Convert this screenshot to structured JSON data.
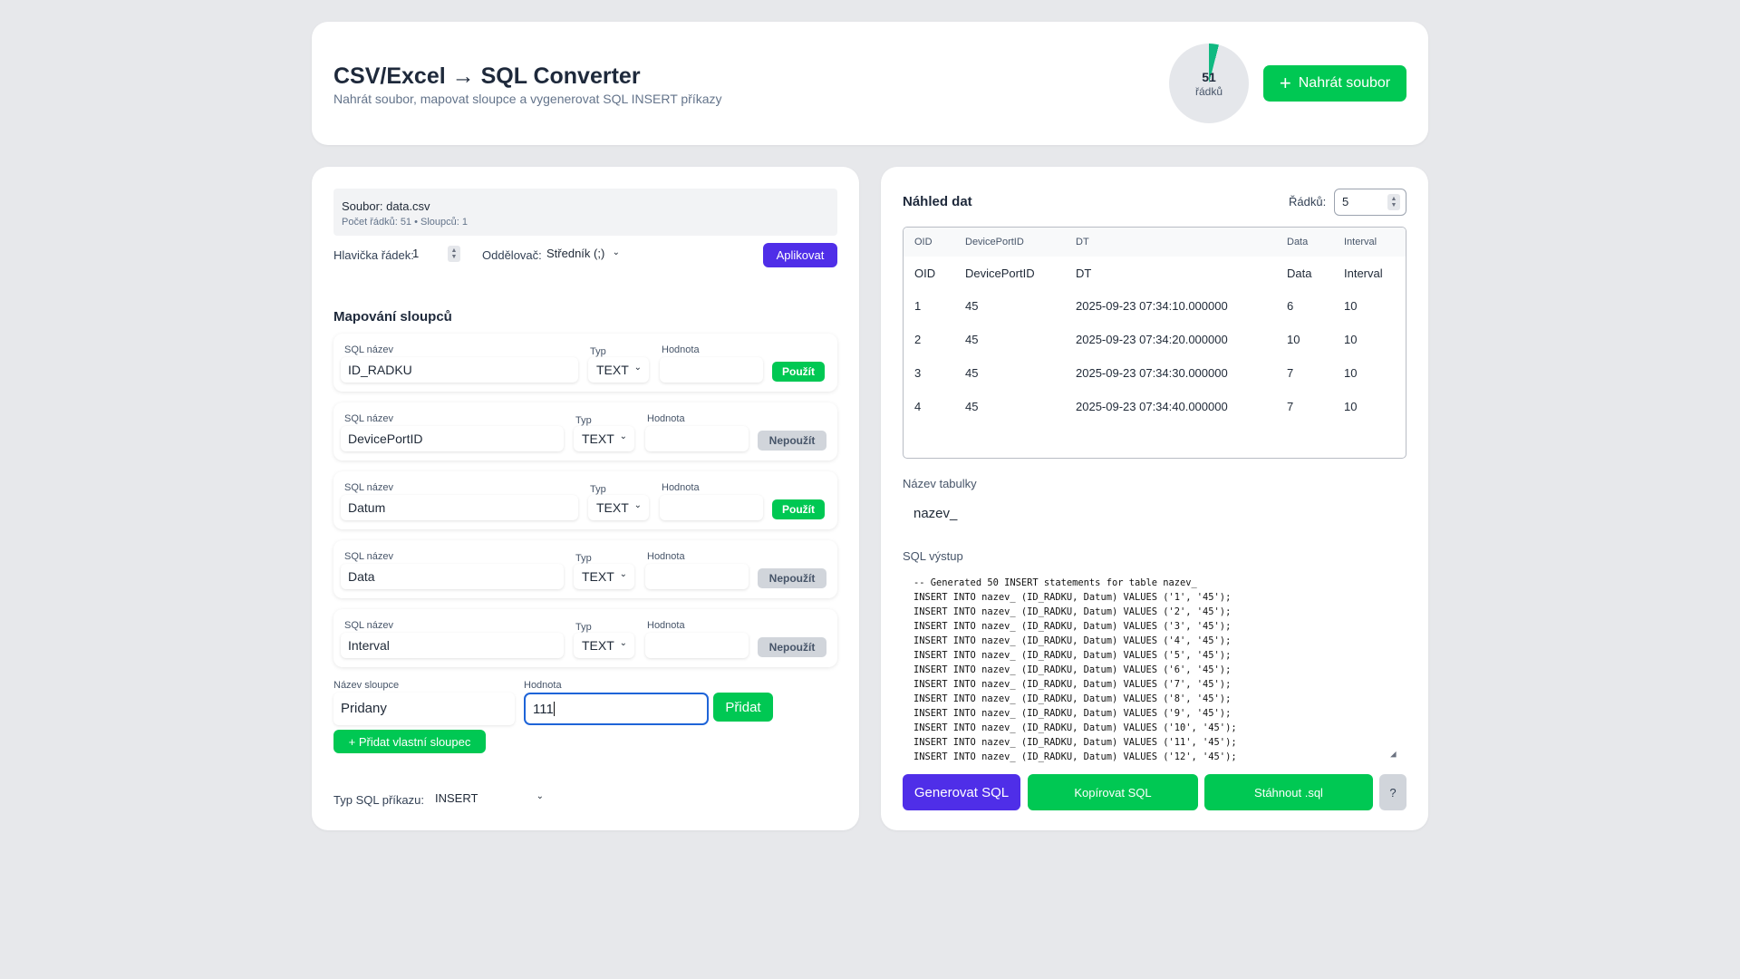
{
  "header": {
    "title": "CSV/Excel → SQL Converter",
    "subtitle": "Nahrát soubor, mapovat sloupce a vygenerovat SQL INSERT příkazy",
    "row_count": "51",
    "row_count_label": "řádků",
    "row_gauge_fraction": 0.04,
    "upload_label": "Nahrát soubor",
    "upload_icon": "plus-icon"
  },
  "file": {
    "name": "Soubor: data.csv",
    "meta": "Počet řádků: 51 • Sloupců: 1"
  },
  "options": {
    "header_row_label": "Hlavička řádek:",
    "header_row_value": "1",
    "delimiter_label": "Oddělovač:",
    "delimiter_value": "Středník (;)",
    "apply_label": "Aplikovat"
  },
  "mapping": {
    "title": "Mapování sloupců",
    "name_caption": "SQL název",
    "type_caption": "Typ",
    "value_caption": "Hodnota",
    "rows": [
      {
        "name": "ID_RADKU",
        "type": "TEXT",
        "value": "",
        "button": "Použít",
        "active": true
      },
      {
        "name": "DevicePortID",
        "type": "TEXT",
        "value": "",
        "button": "Nepoužít",
        "active": false
      },
      {
        "name": "Datum",
        "type": "TEXT",
        "value": "",
        "button": "Použít",
        "active": true
      },
      {
        "name": "Data",
        "type": "TEXT",
        "value": "",
        "button": "Nepoužít",
        "active": false
      },
      {
        "name": "Interval",
        "type": "TEXT",
        "value": "",
        "button": "Nepoužít",
        "active": false
      }
    ]
  },
  "add_column": {
    "name_label": "Název sloupce",
    "name_value": "Pridany",
    "value_label": "Hodnota",
    "value_value": "111",
    "add_label": "Přidat",
    "custom_label": "+ Přidat vlastní sloupec"
  },
  "sql_type": {
    "label": "Typ SQL příkazu:",
    "value": "INSERT"
  },
  "preview": {
    "title": "Náhled dat",
    "rows_label": "Řádků:",
    "rows_value": "5",
    "columns": [
      "OID",
      "DevicePortID",
      "DT",
      "Data",
      "Interval"
    ],
    "rows": [
      [
        "OID",
        "DevicePortID",
        "DT",
        "Data",
        "Interval"
      ],
      [
        "1",
        "45",
        "2025-09-23 07:34:10.000000",
        "6",
        "10"
      ],
      [
        "2",
        "45",
        "2025-09-23 07:34:20.000000",
        "10",
        "10"
      ],
      [
        "3",
        "45",
        "2025-09-23 07:34:30.000000",
        "7",
        "10"
      ],
      [
        "4",
        "45",
        "2025-09-23 07:34:40.000000",
        "7",
        "10"
      ]
    ]
  },
  "table_name": {
    "label": "Název tabulky",
    "value": "nazev_"
  },
  "sql_output": {
    "label": "SQL výstup",
    "lines": [
      "-- Generated 50 INSERT statements for table nazev_",
      "INSERT INTO nazev_ (ID_RADKU, Datum) VALUES ('1', '45');",
      "INSERT INTO nazev_ (ID_RADKU, Datum) VALUES ('2', '45');",
      "INSERT INTO nazev_ (ID_RADKU, Datum) VALUES ('3', '45');",
      "INSERT INTO nazev_ (ID_RADKU, Datum) VALUES ('4', '45');",
      "INSERT INTO nazev_ (ID_RADKU, Datum) VALUES ('5', '45');",
      "INSERT INTO nazev_ (ID_RADKU, Datum) VALUES ('6', '45');",
      "INSERT INTO nazev_ (ID_RADKU, Datum) VALUES ('7', '45');",
      "INSERT INTO nazev_ (ID_RADKU, Datum) VALUES ('8', '45');",
      "INSERT INTO nazev_ (ID_RADKU, Datum) VALUES ('9', '45');",
      "INSERT INTO nazev_ (ID_RADKU, Datum) VALUES ('10', '45');",
      "INSERT INTO nazev_ (ID_RADKU, Datum) VALUES ('11', '45');",
      "INSERT INTO nazev_ (ID_RADKU, Datum) VALUES ('12', '45');"
    ]
  },
  "actions": {
    "generate": "Generovat SQL",
    "copy": "Kopírovat SQL",
    "download": "Stáhnout .sql",
    "help": "?"
  },
  "colors": {
    "primary": "#4f2ee8",
    "success": "#00c853",
    "muted_button": "#d1d5db",
    "focus_border": "#1e64d8"
  }
}
